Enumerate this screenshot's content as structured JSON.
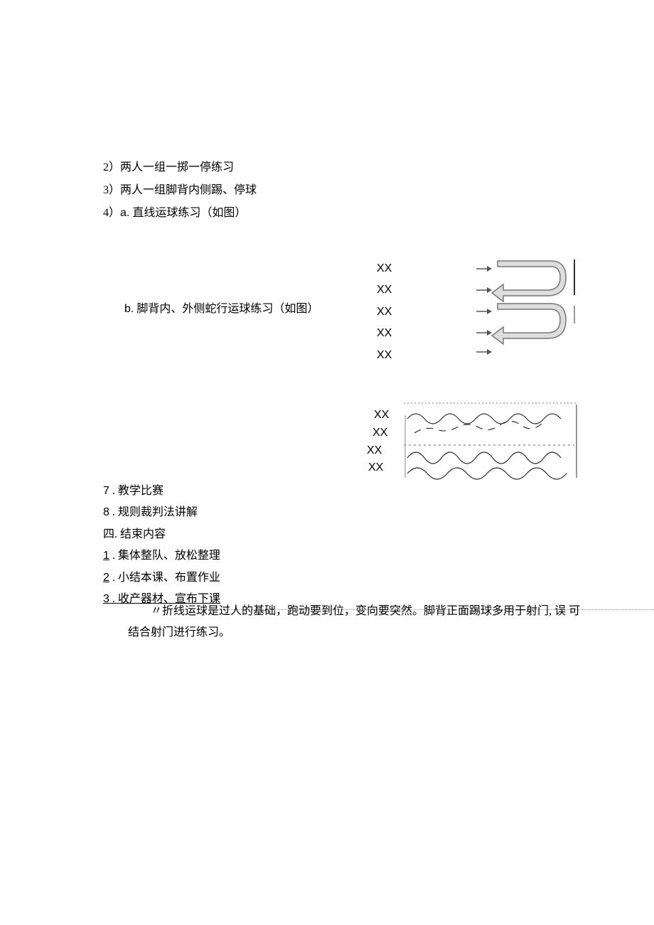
{
  "items": {
    "item2": "2）两人一组一掷一停练习",
    "item3": "3）两人一组脚背内侧踢、停球",
    "item4a_prefix": "4）",
    "item4a_label": "a.",
    "item4a_text": " 直线运球练习（如图）",
    "item4b_label": "b.",
    "item4b_text": " 脚背内、外侧蛇行运球练习（如图）",
    "item7_num": "7",
    "item7_text": " . 教学比赛",
    "item8_num": "8",
    "item8_text": " . 规则裁判法讲解"
  },
  "section4": {
    "heading": "四. 结束内容",
    "item1_num": "1",
    "item1_text": " . 集体整队、放松整理",
    "item2_num": "2",
    "item2_text": " . 小结本课、布置作业",
    "item3_num": "3",
    "item3_text": " . 收产器材、宣布下课"
  },
  "note": {
    "line1": "〃折线运球是过人的基础，跑动要到位，变向要突然。脚背正面踢球多用于射门, 误  可",
    "line2": "结合射门进行练习。"
  },
  "diagram": {
    "xx": "XX"
  }
}
